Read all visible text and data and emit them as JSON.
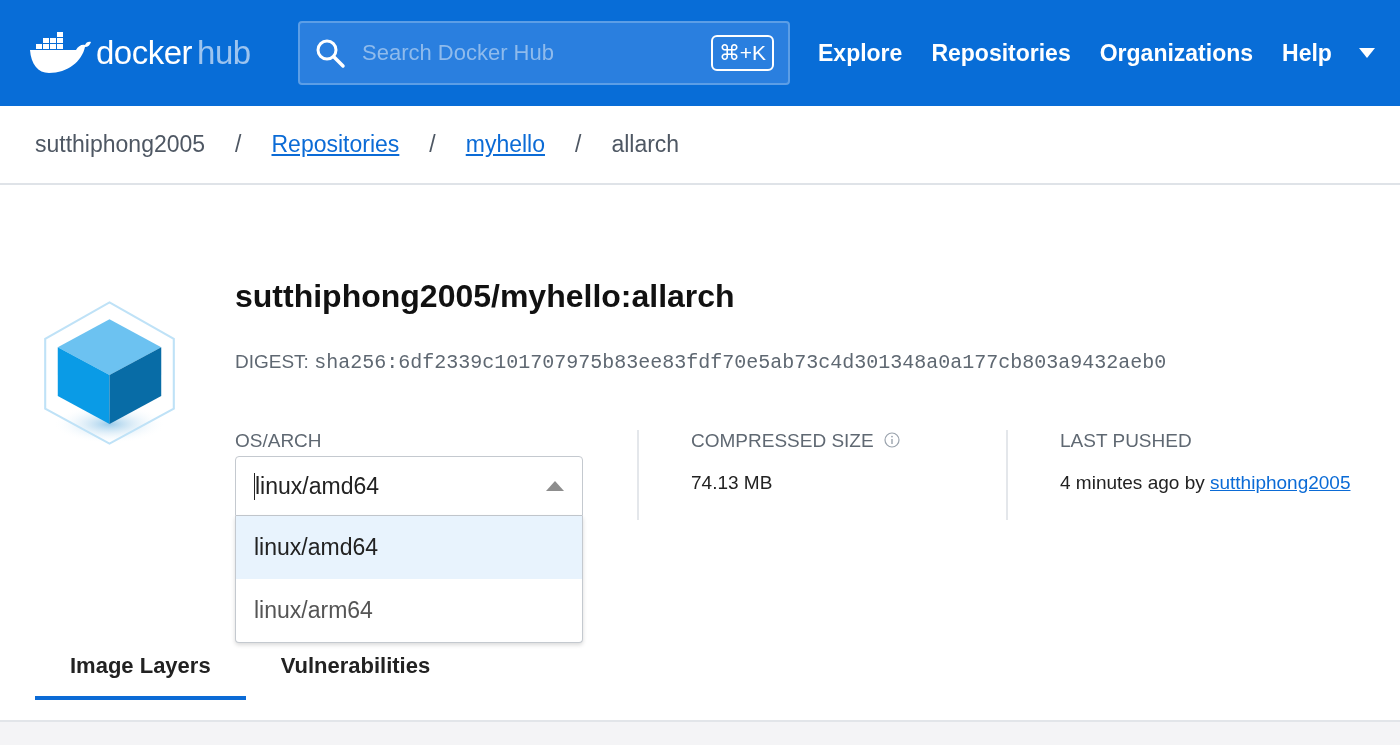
{
  "header": {
    "logo": {
      "word": "docker",
      "suffix": "hub"
    },
    "search": {
      "placeholder": "Search Docker Hub",
      "shortcut": "⌘+K"
    },
    "nav": [
      {
        "label": "Explore"
      },
      {
        "label": "Repositories"
      },
      {
        "label": "Organizations"
      },
      {
        "label": "Help"
      }
    ]
  },
  "breadcrumb": [
    {
      "label": "sutthiphong2005",
      "link": false
    },
    {
      "label": "Repositories",
      "link": true
    },
    {
      "label": "myhello",
      "link": true
    },
    {
      "label": "allarch",
      "link": false
    }
  ],
  "breadcrumb_separator": "/",
  "image": {
    "title": "sutthiphong2005/myhello:allarch",
    "digest_label": "DIGEST:",
    "digest": "sha256:6df2339c101707975b83ee83fdf70e5ab73c4d301348a0a177cb803a9432aeb0"
  },
  "os_arch": {
    "label": "OS/ARCH",
    "value": "linux/amd64",
    "expanded": true,
    "options": [
      {
        "label": "linux/amd64",
        "selected": true
      },
      {
        "label": "linux/arm64",
        "selected": false
      }
    ]
  },
  "compressed_size": {
    "label": "COMPRESSED SIZE",
    "value": "74.13 MB"
  },
  "last_pushed": {
    "label": "LAST PUSHED",
    "text": "4 minutes ago by",
    "user": "sutthiphong2005"
  },
  "tabs": [
    {
      "label": "Image Layers",
      "selected": true
    },
    {
      "label": "Vulnerabilities",
      "selected": false
    }
  ]
}
